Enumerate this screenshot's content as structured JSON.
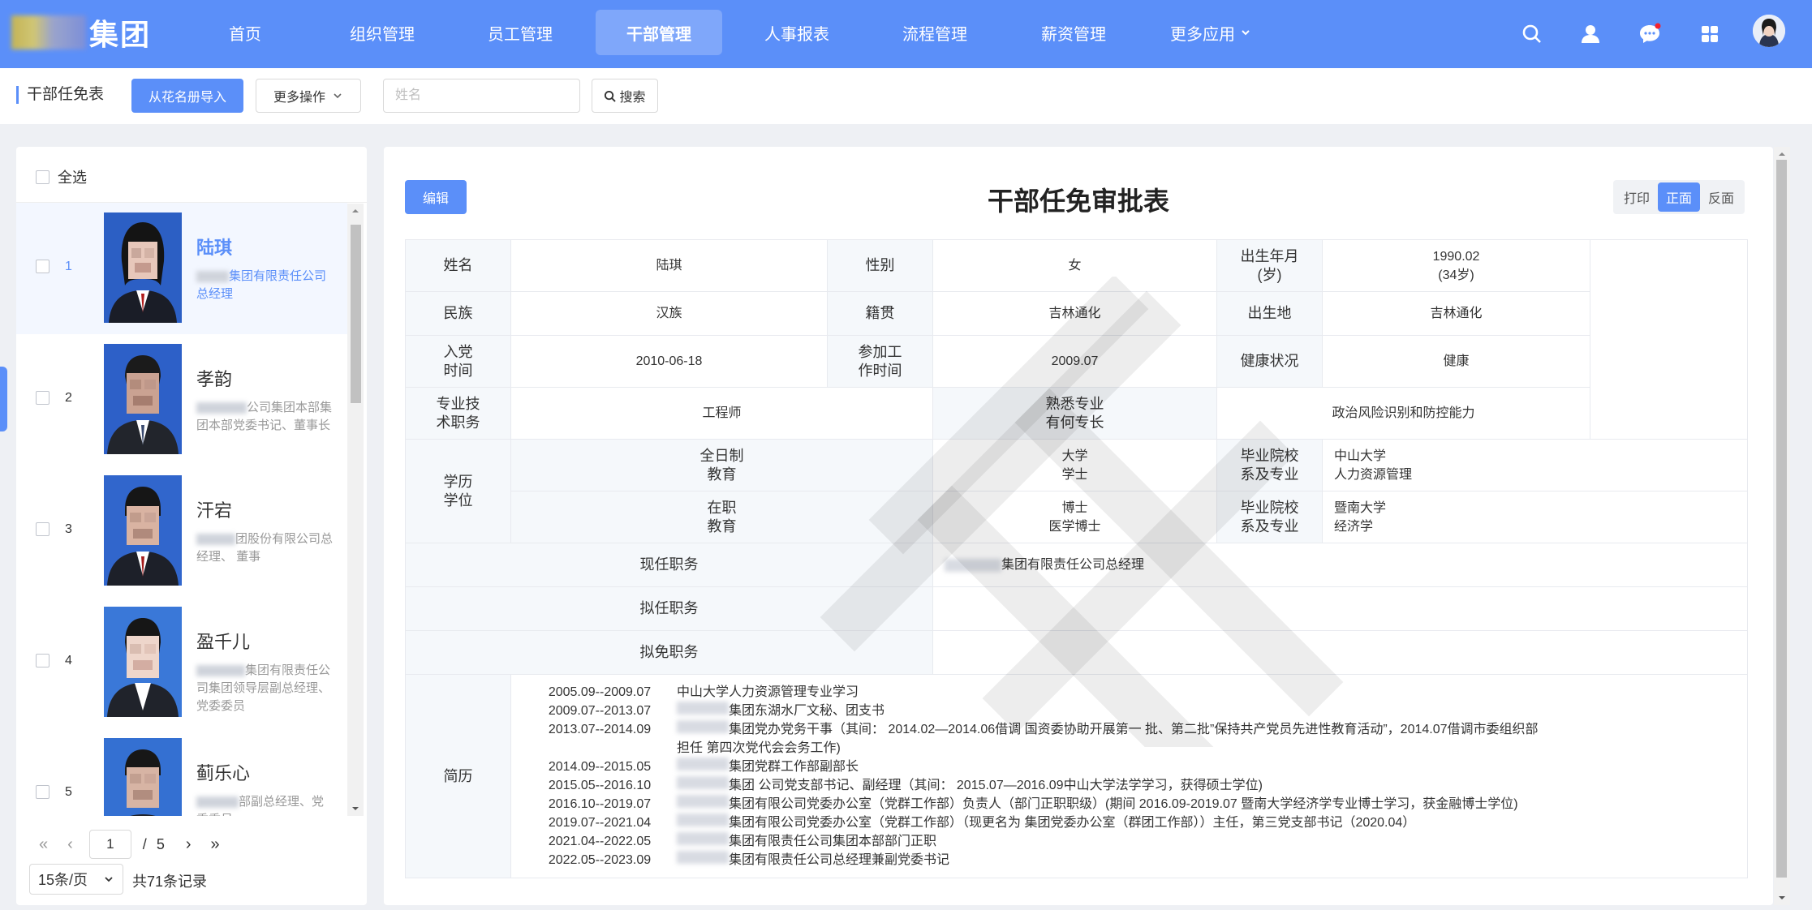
{
  "brand": {
    "logo_text": "集团"
  },
  "nav": {
    "items": [
      "首页",
      "组织管理",
      "员工管理",
      "干部管理",
      "人事报表",
      "流程管理",
      "薪资管理",
      "更多应用"
    ],
    "active": "干部管理"
  },
  "toolbar": {
    "title": "干部任免表",
    "import_label": "从花名册导入",
    "more_label": "更多操作",
    "search_placeholder": "姓名",
    "search_label": "搜索"
  },
  "left": {
    "select_all": "全选",
    "items": [
      {
        "num": "1",
        "name": "陆琪",
        "desc": "集团有限责任公司总经理"
      },
      {
        "num": "2",
        "name": "孝韵",
        "desc": "公司集团本部集团本部党委书记、董事长"
      },
      {
        "num": "3",
        "name": "汗宕",
        "desc": "团股份有限公司总经理、 董事"
      },
      {
        "num": "4",
        "name": "盈千儿",
        "desc": "集团有限责任公司集团领导层副总经理、党委委员"
      },
      {
        "num": "5",
        "name": "蓟乐心",
        "desc": "部副总经理、党委委员"
      }
    ],
    "pager": {
      "current": "1",
      "sep": "/",
      "total_pages": "5",
      "page_size": "15条/页",
      "total": "共71条记录"
    }
  },
  "form": {
    "edit_label": "编辑",
    "title": "干部任免审批表",
    "toggles": [
      "打印",
      "正面",
      "反面"
    ],
    "active_toggle": "正面",
    "labels": {
      "name": "姓名",
      "gender": "性别",
      "birth": "出生年月\n(岁)",
      "ethnic": "民族",
      "native": "籍贯",
      "birthplace": "出生地",
      "party": "入党\n时间",
      "work": "参加工\n作时间",
      "health": "健康状况",
      "title_prof": "专业技\n术职务",
      "specialty": "熟悉专业\n有何专长",
      "edu": "学历\n学位",
      "fulltime": "全日制\n教育",
      "parttime": "在职\n教育",
      "school1": "毕业院校\n系及专业",
      "school2": "毕业院校\n系及专业",
      "current_pos": "现任职务",
      "proposed_pos": "拟任职务",
      "proposed_remove": "拟免职务",
      "resume": "简历"
    },
    "values": {
      "name": "陆琪",
      "gender": "女",
      "birth": "1990.02\n(34岁)",
      "ethnic": "汉族",
      "native": "吉林通化",
      "birthplace": "吉林通化",
      "party": "2010-06-18",
      "work": "2009.07",
      "health": "健康",
      "title_prof": "工程师",
      "specialty": "政治风险识别和防控能力",
      "fulltime_deg": "大学\n学士",
      "fulltime_school": "中山大学\n人力资源管理",
      "parttime_deg": "博士\n医学博士",
      "parttime_school": "暨南大学\n经济学",
      "current_pos": "集团有限责任公司总经理",
      "proposed_pos": "",
      "proposed_remove": ""
    },
    "resume": [
      {
        "date": "2005.09--2009.07",
        "text": "中山大学人力资源管理专业学习"
      },
      {
        "date": "2009.07--2013.07",
        "text": "集团东湖水厂文秘、团支书"
      },
      {
        "date": "2013.07--2014.09",
        "text": "集团党办党务干事（其间： 2014.02—2014.06借调 国资委协助开展第一 批、第二批”保持共产党员先进性教育活动”，2014.07借调市委组织部"
      },
      {
        "date": "",
        "text": "担任 第四次党代会会务工作)"
      },
      {
        "date": "2014.09--2015.05",
        "text": "集团党群工作部副部长"
      },
      {
        "date": "2015.05--2016.10",
        "text": "集团 公司党支部书记、副经理（其间： 2015.07—2016.09中山大学法学学习，获得硕士学位)"
      },
      {
        "date": "2016.10--2019.07",
        "text": "集团有限公司党委办公室（党群工作部）负责人（部门正职职级）(期间 2016.09-2019.07 暨南大学经济学专业博士学习，获金融博士学位)"
      },
      {
        "date": "2019.07--2021.04",
        "text": "集团有限公司党委办公室（党群工作部）（现更名为 集团党委办公室（群团工作部））主任，第三党支部书记（2020.04）"
      },
      {
        "date": "2021.04--2022.05",
        "text": "集团有限责任公司集团本部部门正职"
      },
      {
        "date": "2022.05--2023.09",
        "text": "集团有限责任公司总经理兼副党委书记"
      }
    ]
  },
  "colors": {
    "primary": "#5b8ff9",
    "header_bg": "#5b8ff9",
    "label_bg": "#f5f8fb"
  }
}
